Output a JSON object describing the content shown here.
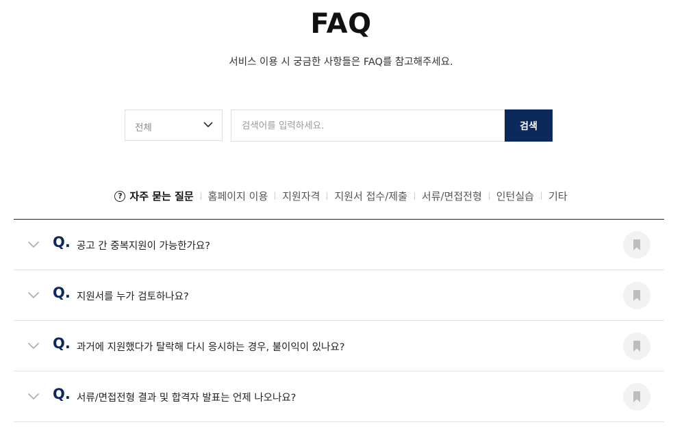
{
  "header": {
    "title": "FAQ",
    "subtitle": "서비스 이용 시 궁금한 사항들은 FAQ를 참고해주세요."
  },
  "search": {
    "category_value": "전체",
    "placeholder": "검색어를 입력하세요.",
    "button_label": "검색",
    "button_color": "#0b2a5b"
  },
  "tabs": [
    {
      "label": "자주 묻는 질문",
      "active": true,
      "icon": "question-circle-icon"
    },
    {
      "label": "홈페이지 이용",
      "active": false
    },
    {
      "label": "지원자격",
      "active": false
    },
    {
      "label": "지원서 접수/제출",
      "active": false
    },
    {
      "label": "서류/면접전형",
      "active": false
    },
    {
      "label": "인턴실습",
      "active": false
    },
    {
      "label": "기타",
      "active": false
    }
  ],
  "faq": {
    "q_mark": "Q.",
    "items": [
      {
        "question": "공고 간 중복지원이 가능한가요?"
      },
      {
        "question": "지원서를 누가 검토하나요?"
      },
      {
        "question": "과거에 지원했다가 탈락해 다시 응시하는 경우, 불이익이 있나요?"
      },
      {
        "question": "서류/면접전형 결과 및 합격자 발표는 언제 나오나요?"
      }
    ]
  }
}
